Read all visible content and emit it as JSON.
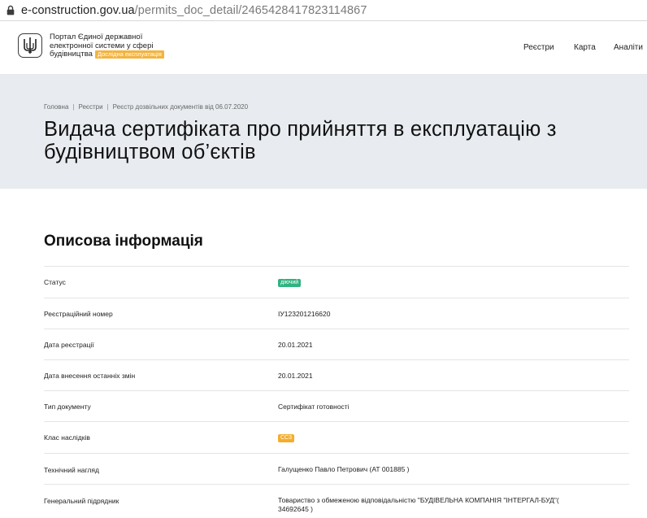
{
  "browser": {
    "url_host": "e-construction.gov.ua",
    "url_path": "/permits_doc_detail/2465428417823114867"
  },
  "header": {
    "portal_lines": [
      "Портал Єдиної державної",
      "електронної системи у сфері",
      "будівництва"
    ],
    "beta_label": "Дослідна експлуатація",
    "nav": [
      "Реєстри",
      "Карта",
      "Аналіти"
    ]
  },
  "hero": {
    "breadcrumb": [
      "Головна",
      "Реєстри",
      "Реєстр дозвільних документів від 06.07.2020"
    ],
    "title_lines": [
      "Видача сертифіката про прийняття в експлуатацію з",
      "будівництвом об’єктів"
    ]
  },
  "section": {
    "title": "Описова інформація",
    "rows": [
      {
        "label": "Статус",
        "value": "діючий",
        "badge": "green"
      },
      {
        "label": "Реєстраційний номер",
        "value": "ІУ123201216620"
      },
      {
        "label": "Дата реєстрації",
        "value": "20.01.2021"
      },
      {
        "label": "Дата внесення останніх змін",
        "value": "20.01.2021"
      },
      {
        "label": "Тип документу",
        "value": "Сертифікат готовності"
      },
      {
        "label": "Клас наслідків",
        "value": "СС3",
        "badge": "orange"
      },
      {
        "label": "Технічний нагляд",
        "value": "Галущенко Павло Петрович (АТ 001885 )"
      },
      {
        "label": "Генеральний підрядник",
        "value_lines": [
          "Товариство з обмеженою відповідальністю \"БУДІВЕЛЬНА КОМПАНІЯ \"ІНТЕРГАЛ-БУД\"(",
          "34692645 )"
        ]
      }
    ]
  },
  "colors": {
    "hero_bg": "#e8ecf0",
    "badge_green": "#2fb380",
    "badge_orange": "#f3ae2d",
    "beta_badge": "#f3b43f"
  },
  "icons": {
    "lock": "lock-icon",
    "logo": "trident-emblem-icon"
  }
}
